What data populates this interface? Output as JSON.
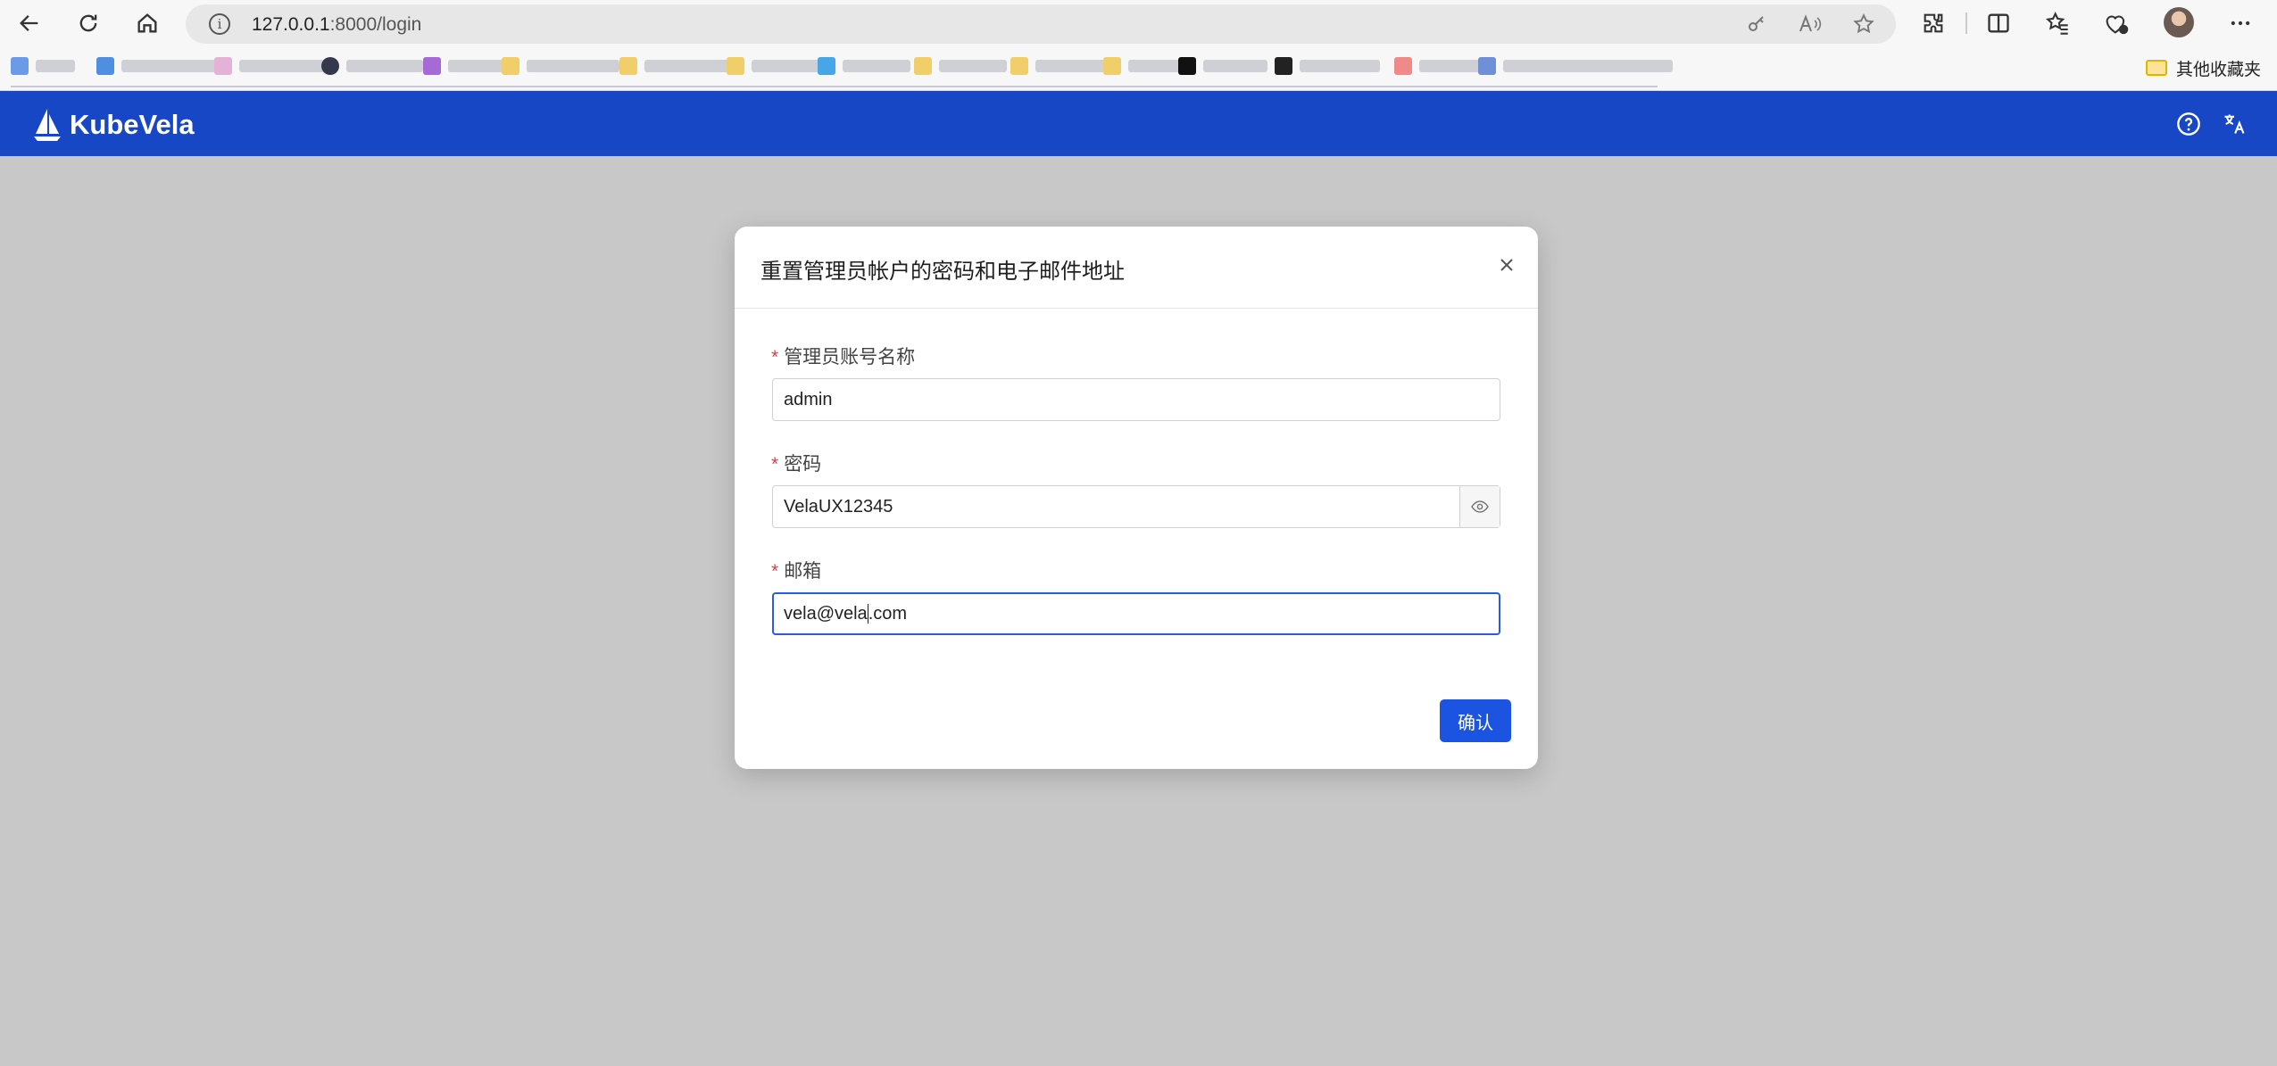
{
  "browser": {
    "url_host": "127.0.0.1",
    "url_rest": ":8000/login",
    "other_bookmarks_label": "其他收藏夹"
  },
  "app": {
    "logo_text": "KubeVela",
    "brand_color": "#1847c6",
    "help_icon": "question-circle-icon",
    "language_icon": "translate-icon"
  },
  "modal": {
    "title": "重置管理员帐户的密码和电子邮件地址",
    "fields": [
      {
        "label": "管理员账号名称",
        "value": "admin",
        "required_mark": "*"
      },
      {
        "label": "密码",
        "value": "VelaUX12345",
        "required_mark": "*"
      },
      {
        "label": "邮箱",
        "value_before_caret": "vela@vela",
        "value_after_caret": ".com",
        "required_mark": "*"
      }
    ],
    "confirm_label": "确认",
    "accent_color": "#1b54e0"
  }
}
